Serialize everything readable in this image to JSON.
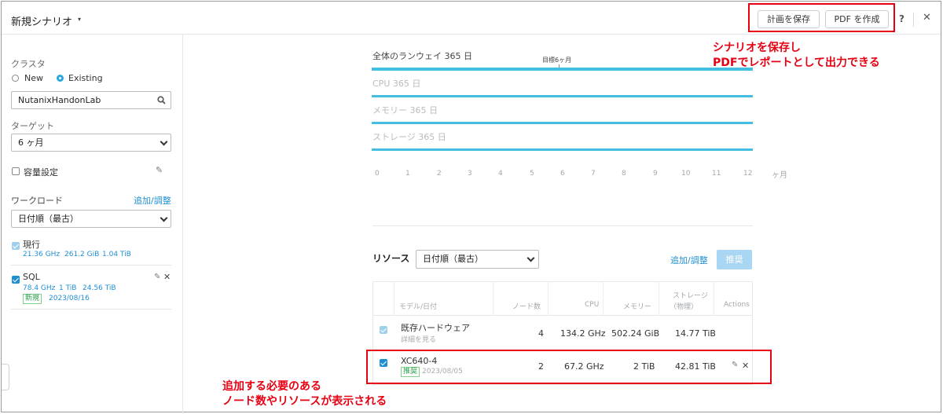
{
  "header": {
    "scenario_title": "新規シナリオ",
    "caret": "▾",
    "save_plan_label": "計画を保存",
    "create_pdf_label": "PDF を作成",
    "help_label": "?",
    "close_label": "✕"
  },
  "left": {
    "cluster_label": "クラスタ",
    "cluster_options": [
      "New",
      "Existing"
    ],
    "cluster_selected": "Existing",
    "cluster_value": "NutanixHandonLab",
    "target_label": "ターゲット",
    "target_value": "6 ヶ月",
    "capacity_label": "容量設定",
    "workload_label": "ワークロード",
    "workload_add_link": "追加/調整",
    "workload_sort": "日付順（最古）",
    "workloads": [
      {
        "name": "現行",
        "stats": [
          "21.36 GHz",
          "261.2 GiB",
          "1.04 TiB"
        ]
      },
      {
        "name": "SQL",
        "stats": [
          "78.4 GHz",
          "1 TiB",
          "24.56 TiB"
        ],
        "badge": "新規",
        "date": "2023/08/16"
      }
    ]
  },
  "chart": {
    "overall_label": "全体のランウェイ 365 日",
    "cpu_label": "CPU 365 日",
    "memory_label": "メモリー 365 日",
    "storage_label": "ストレージ 365 日",
    "target_marker_label": "目標6ヶ月",
    "x_ticks": [
      "0",
      "1",
      "2",
      "3",
      "4",
      "5",
      "6",
      "7",
      "8",
      "9",
      "10",
      "11",
      "12"
    ],
    "x_unit": "ヶ月",
    "bar_color": "#43bee0"
  },
  "resources": {
    "title": "リソース",
    "sort_value": "日付順（最古）",
    "add_link": "追加/調整",
    "recommend_button": "推奨",
    "columns": [
      "モデル/日付",
      "ノード数",
      "CPU",
      "メモリー",
      "ストレージ",
      "（物理）",
      "Actions"
    ],
    "rows": [
      {
        "model": "既存ハードウェア",
        "sub": "詳細を見る",
        "nodes": "4",
        "cpu": "134.2 GHz",
        "memory": "502.24 GiB",
        "storage": "14.77 TiB"
      },
      {
        "model": "XC640-4",
        "badge": "推奨",
        "sub": "2023/08/05",
        "nodes": "2",
        "cpu": "67.2 GHz",
        "memory": "2 TiB",
        "storage": "42.81 TiB"
      }
    ]
  },
  "annotations": {
    "top_line1": "シナリオを保存し",
    "top_line2": "PDFでレポートとして出力できる",
    "bottom_line1": "追加する必要のある",
    "bottom_line2": "ノード数やリソースが表示される",
    "color": "#e60012"
  }
}
